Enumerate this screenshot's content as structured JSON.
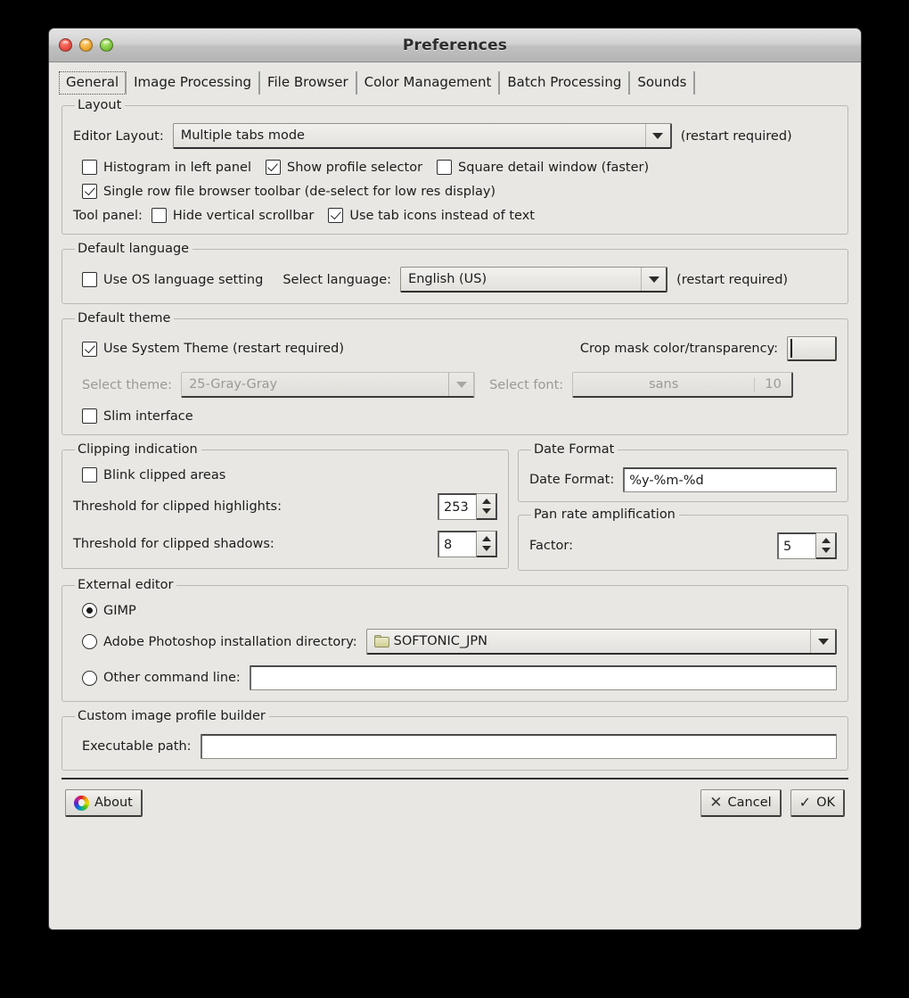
{
  "window": {
    "title": "Preferences",
    "traffic_lights": [
      "close",
      "minimize",
      "maximize"
    ]
  },
  "tabs": [
    {
      "label": "General",
      "active": true
    },
    {
      "label": "Image Processing",
      "active": false
    },
    {
      "label": "File Browser",
      "active": false
    },
    {
      "label": "Color Management",
      "active": false
    },
    {
      "label": "Batch Processing",
      "active": false
    },
    {
      "label": "Sounds",
      "active": false
    }
  ],
  "layout": {
    "legend": "Layout",
    "editor_layout_label": "Editor Layout:",
    "editor_layout_value": "Multiple tabs mode",
    "restart_note": "(restart required)",
    "histogram_label": "Histogram in left panel",
    "histogram_checked": false,
    "profile_selector_label": "Show profile selector",
    "profile_selector_checked": true,
    "square_detail_label": "Square detail window (faster)",
    "square_detail_checked": false,
    "single_row_label": "Single row file browser toolbar (de-select for low res display)",
    "single_row_checked": true,
    "tool_panel_label": "Tool panel:",
    "hide_scrollbar_label": "Hide vertical scrollbar",
    "hide_scrollbar_checked": false,
    "tab_icons_label": "Use tab icons instead of text",
    "tab_icons_checked": true
  },
  "language": {
    "legend": "Default language",
    "use_os_label": "Use OS language setting",
    "use_os_checked": false,
    "select_label": "Select language:",
    "select_value": "English (US)",
    "restart_note": "(restart required)"
  },
  "theme": {
    "legend": "Default theme",
    "use_system_label": "Use System Theme  (restart required)",
    "use_system_checked": true,
    "crop_mask_label": "Crop mask color/transparency:",
    "select_theme_label": "Select theme:",
    "select_theme_value": "25-Gray-Gray",
    "select_font_label": "Select font:",
    "font_name": "sans",
    "font_size": "10",
    "slim_label": "Slim interface",
    "slim_checked": false
  },
  "clipping": {
    "legend": "Clipping indication",
    "blink_label": "Blink clipped areas",
    "blink_checked": false,
    "highlights_label": "Threshold for clipped highlights:",
    "highlights_value": "253",
    "shadows_label": "Threshold for clipped shadows:",
    "shadows_value": "8"
  },
  "date_format": {
    "legend": "Date Format",
    "label": "Date Format:",
    "value": "%y-%m-%d"
  },
  "pan_rate": {
    "legend": "Pan rate amplification",
    "label": "Factor:",
    "value": "5"
  },
  "external_editor": {
    "legend": "External editor",
    "gimp_label": "GIMP",
    "gimp_selected": true,
    "photoshop_label": "Adobe Photoshop installation directory:",
    "photoshop_selected": false,
    "photoshop_value": "SOFTONIC_JPN",
    "other_label": "Other command line:",
    "other_selected": false,
    "other_value": ""
  },
  "profile_builder": {
    "legend": "Custom image profile builder",
    "label": "Executable path:",
    "value": ""
  },
  "buttons": {
    "about": "About",
    "cancel": "Cancel",
    "ok": "OK"
  }
}
